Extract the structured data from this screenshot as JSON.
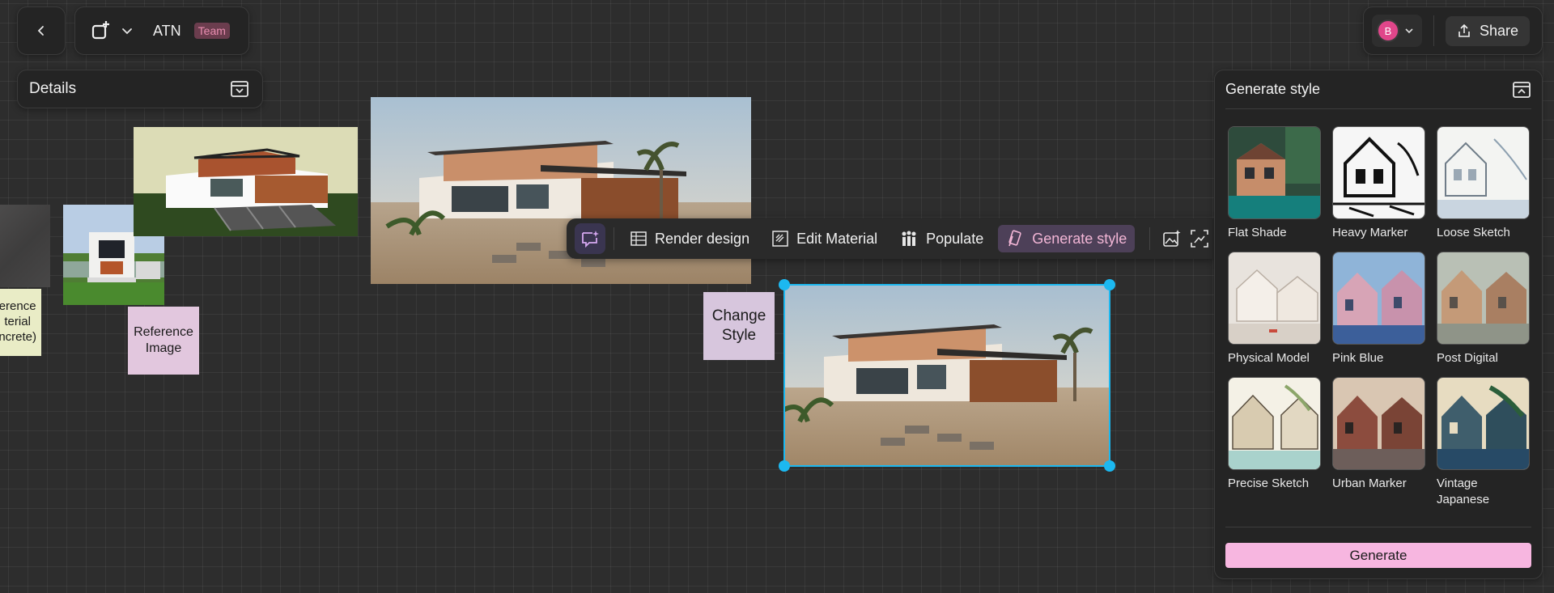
{
  "header": {
    "project_name": "ATN",
    "team_badge": "Team",
    "avatar_initial": "B",
    "share_label": "Share"
  },
  "details_panel": {
    "title": "Details"
  },
  "canvas": {
    "notes": {
      "reference_material": "erence\nterial\nncrete)",
      "reference_image": "Reference\nImage",
      "change_style": "Change\nStyle"
    }
  },
  "toolbar": {
    "render_design": "Render design",
    "edit_material": "Edit Material",
    "populate": "Populate",
    "generate_style": "Generate style"
  },
  "style_panel": {
    "title": "Generate style",
    "styles": [
      {
        "label": "Flat Shade"
      },
      {
        "label": "Heavy Marker"
      },
      {
        "label": "Loose Sketch"
      },
      {
        "label": "Physical Model"
      },
      {
        "label": "Pink Blue"
      },
      {
        "label": "Post Digital"
      },
      {
        "label": "Precise Sketch"
      },
      {
        "label": "Urban Marker"
      },
      {
        "label": "Vintage Japanese"
      }
    ],
    "generate_label": "Generate"
  },
  "colors": {
    "accent": "#1cb8f0",
    "generate_button": "#f7b6e0",
    "active_tool": "#4d4058",
    "canvas_bg": "#2d2d2d"
  }
}
